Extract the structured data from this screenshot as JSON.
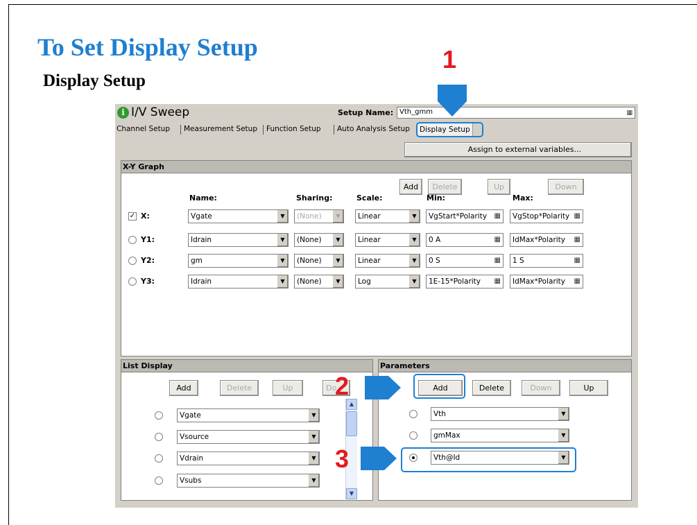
{
  "slide": {
    "title": "To Set Display Setup",
    "subtitle": "Display Setup"
  },
  "callouts": [
    "1",
    "2",
    "3"
  ],
  "colors": {
    "accent": "#1f7fd0",
    "callout_number": "#e31a1c",
    "window_bg": "#d4d0c8"
  },
  "window": {
    "title": "I/V Sweep",
    "info_icon_glyph": "i",
    "setup_name_label": "Setup Name:",
    "setup_name_value": "Vth_gmm",
    "tabs": [
      "Channel Setup",
      "Measurement Setup",
      "Function Setup",
      "Auto Analysis Setup",
      "Display Setup"
    ],
    "active_tab": "Display Setup",
    "assign_button": "Assign to external variables..."
  },
  "xy_graph": {
    "title": "X-Y Graph",
    "buttons": {
      "add": "Add",
      "delete": "Delete",
      "up": "Up",
      "down": "Down"
    },
    "columns": {
      "name": "Name:",
      "sharing": "Sharing:",
      "scale": "Scale:",
      "min": "Min:",
      "max": "Max:"
    },
    "rows": [
      {
        "axis": "X:",
        "name": "Vgate",
        "sharing": "(None)",
        "scale": "Linear",
        "min": "VgStart*Polarity",
        "max": "VgStop*Polarity",
        "checked": true
      },
      {
        "axis": "Y1:",
        "name": "Idrain",
        "sharing": "(None)",
        "scale": "Linear",
        "min": "0 A",
        "max": "IdMax*Polarity"
      },
      {
        "axis": "Y2:",
        "name": "gm",
        "sharing": "(None)",
        "scale": "Linear",
        "min": "0 S",
        "max": "1 S"
      },
      {
        "axis": "Y3:",
        "name": "Idrain",
        "sharing": "(None)",
        "scale": "Log",
        "min": "1E-15*Polarity",
        "max": "IdMax*Polarity"
      }
    ]
  },
  "list_display": {
    "title": "List Display",
    "buttons": {
      "add": "Add",
      "delete": "Delete",
      "up": "Up",
      "down": "Do"
    },
    "items": [
      "Vgate",
      "Vsource",
      "Vdrain",
      "Vsubs"
    ]
  },
  "parameters": {
    "title": "Parameters",
    "buttons": {
      "add": "Add",
      "delete": "Delete",
      "down": "Down",
      "up": "Up"
    },
    "items": [
      "Vth",
      "gmMax",
      "Vth@Id"
    ],
    "selected": "Vth@Id"
  }
}
